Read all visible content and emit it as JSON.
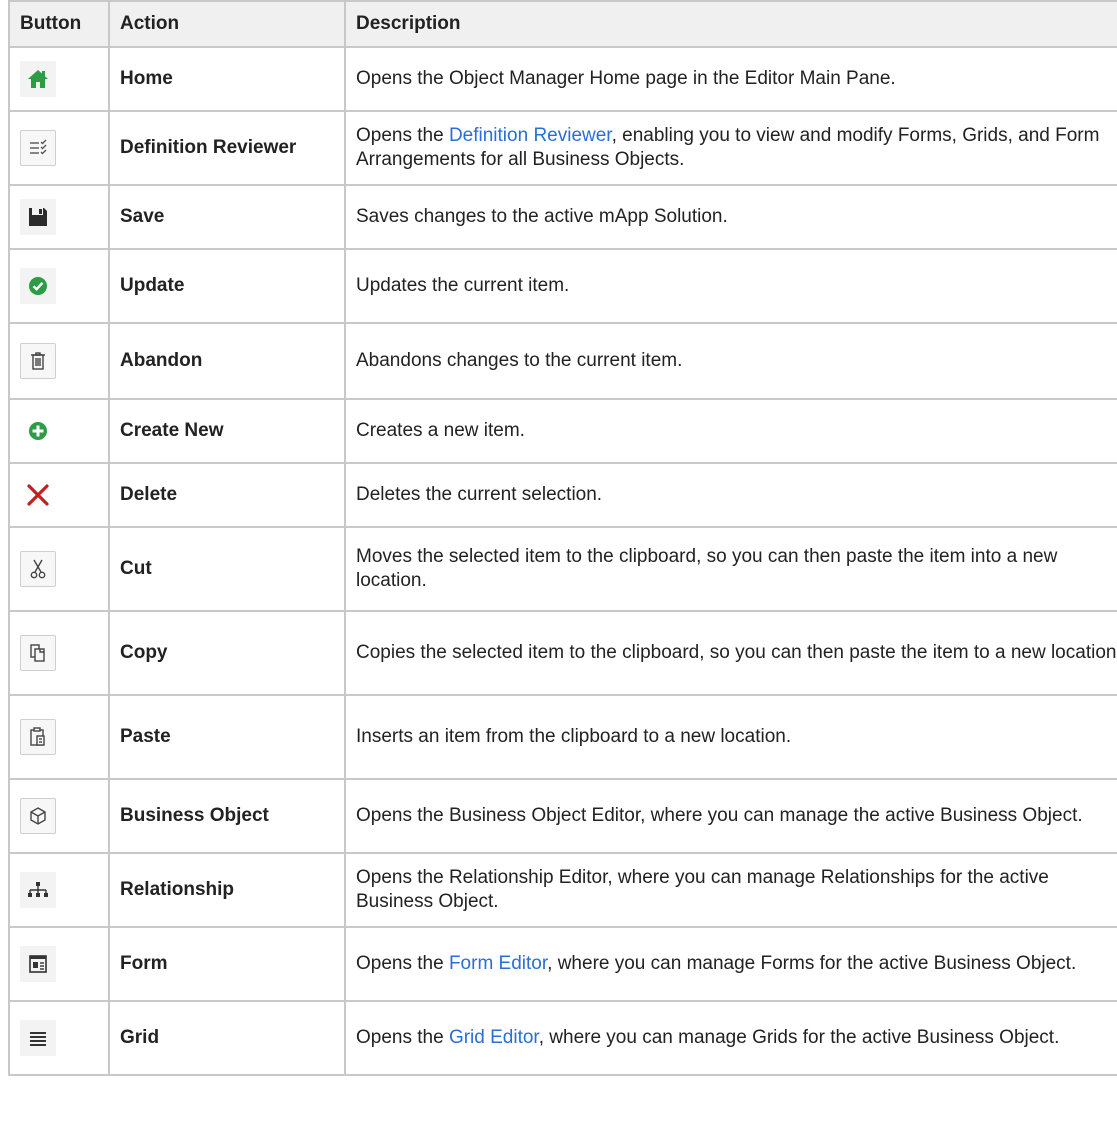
{
  "header": {
    "button": "Button",
    "action": "Action",
    "description": "Description"
  },
  "colors": {
    "link": "#2a6ed8",
    "home_green": "#2e9b46",
    "delete_red": "#c0201f",
    "header_bg": "#f0f0f0"
  },
  "rows": [
    {
      "icon": "home-icon",
      "action": "Home",
      "desc": "Opens the Object Manager Home page in the Editor Main Pane."
    },
    {
      "icon": "checklist-icon",
      "action": "Definition Reviewer",
      "desc_pre": "Opens the ",
      "desc_link": "Definition Reviewer",
      "desc_post": ", enabling you to view and modify Forms, Grids, and Form Arrangements for all Business Objects."
    },
    {
      "icon": "save-icon",
      "action": "Save",
      "desc": "Saves changes to the active mApp Solution."
    },
    {
      "icon": "check-circle-icon",
      "action": "Update",
      "desc": "Updates the current item."
    },
    {
      "icon": "trash-icon",
      "action": "Abandon",
      "desc": "Abandons changes to the current item."
    },
    {
      "icon": "plus-circle-icon",
      "action": "Create New",
      "desc": "Creates a new item."
    },
    {
      "icon": "x-icon",
      "action": "Delete",
      "desc": "Deletes the current selection."
    },
    {
      "icon": "scissors-icon",
      "action": "Cut",
      "desc": "Moves the selected item to the clipboard, so you can then paste the item into a new location."
    },
    {
      "icon": "copy-icon",
      "action": "Copy",
      "desc": "Copies the selected item to the clipboard, so you can then paste the item to a new location."
    },
    {
      "icon": "paste-icon",
      "action": "Paste",
      "desc": "Inserts an item from the clipboard to a new location."
    },
    {
      "icon": "cube-icon",
      "action": "Business Object",
      "desc": "Opens the Business Object Editor, where you can manage the active Business Object."
    },
    {
      "icon": "hierarchy-icon",
      "action": "Relationship",
      "desc": "Opens the Relationship Editor, where you can manage Relationships for the active Business Object."
    },
    {
      "icon": "form-icon",
      "action": "Form",
      "desc_pre": "Opens the ",
      "desc_link": "Form Editor",
      "desc_post": ", where you can manage Forms for the active Business Object."
    },
    {
      "icon": "grid-lines-icon",
      "action": "Grid",
      "desc_pre": "Opens the ",
      "desc_link": "Grid Editor",
      "desc_post": ", where you can manage Grids for the active Business Object."
    }
  ]
}
